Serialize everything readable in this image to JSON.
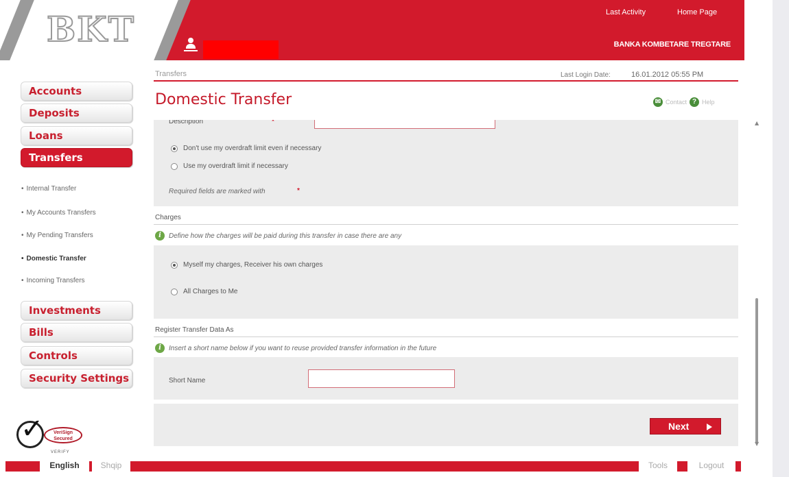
{
  "header": {
    "logo_text": "BKT",
    "last_activity": "Last Activity",
    "home_page": "Home Page",
    "bank_name": "BANKA KOMBETARE TREGTARE"
  },
  "sidebar": {
    "menu": [
      {
        "label": "Accounts"
      },
      {
        "label": "Deposits"
      },
      {
        "label": "Loans"
      },
      {
        "label": "Transfers"
      }
    ],
    "submenu": [
      {
        "label": "Internal Transfer"
      },
      {
        "label": "My Accounts Transfers"
      },
      {
        "label": "My Pending Transfers"
      },
      {
        "label": "Domestic Transfer"
      },
      {
        "label": "Incoming Transfers"
      }
    ],
    "menu2": [
      {
        "label": "Investments"
      },
      {
        "label": "Bills"
      },
      {
        "label": "Controls"
      },
      {
        "label": "Security Settings"
      }
    ]
  },
  "main": {
    "breadcrumb": "Transfers",
    "last_login_label": "Last Login Date:",
    "last_login_value": "16.01.2012 05:55 PM",
    "title": "Domestic Transfer",
    "contact": "Contact",
    "help": "Help",
    "description_label": "Description",
    "overdraft_option1": "Don't use my overdraft limit even if necessary",
    "overdraft_option2": "Use my overdraft limit if necessary",
    "required_note": "Required fields are marked with",
    "charges_heading": "Charges",
    "charges_info": "Define how the charges will be paid during this transfer in case there are any",
    "charges_option1": "Myself my charges, Receiver his own charges",
    "charges_option2": "All Charges to Me",
    "register_heading": "Register Transfer Data As",
    "register_info": "Insert a short name below if you want to reuse provided transfer information in the future",
    "short_name_label": "Short Name",
    "short_name_value": "",
    "next_label": "Next"
  },
  "verisign": {
    "line1": "VeriSign",
    "line2": "Secured",
    "verify": "VERIFY"
  },
  "footer": {
    "english": "English",
    "shqip": "Shqip",
    "tools": "Tools",
    "logout": "Logout"
  },
  "colors": {
    "brand_red": "#d21a2c",
    "info_green": "#6da746"
  }
}
